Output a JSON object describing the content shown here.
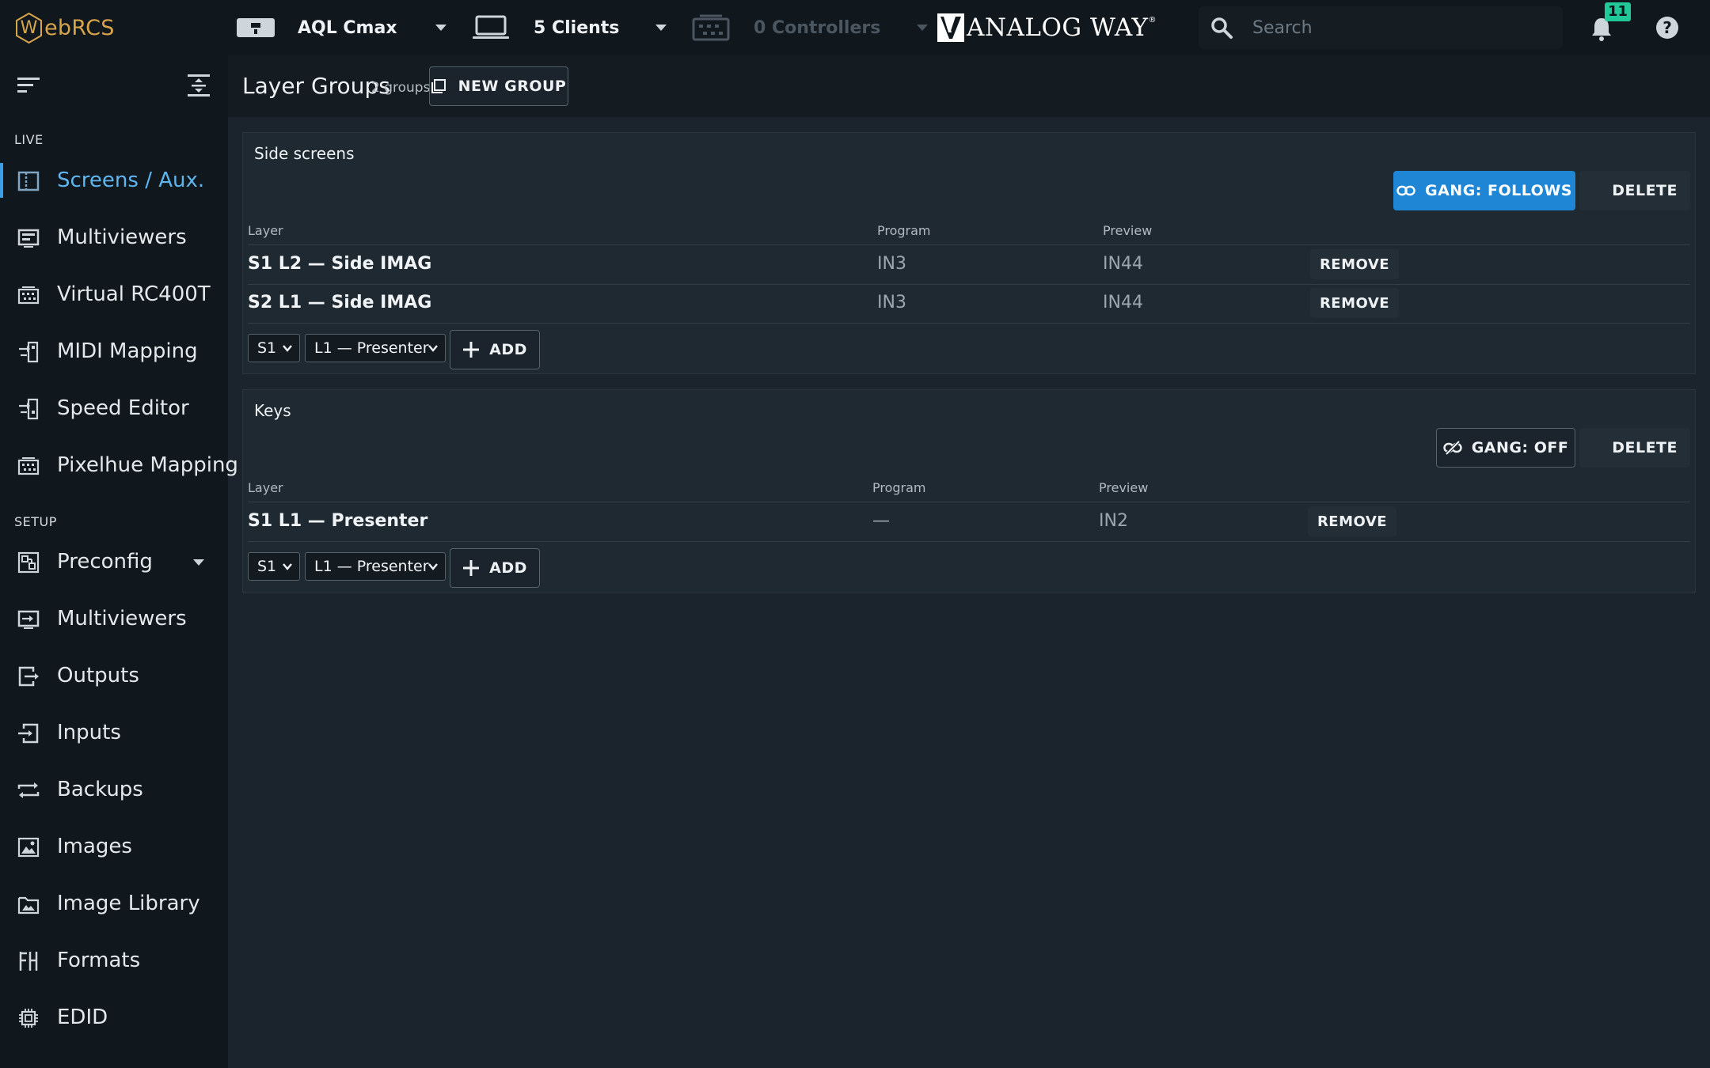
{
  "app": {
    "logo_letter": "W",
    "logo_rest": "ebRCS"
  },
  "topbar": {
    "device": "AQL Cmax",
    "clients": "5 Clients",
    "controllers": "0 Controllers",
    "brand": "ANALOG WAY",
    "brand_reg": "®",
    "search_placeholder": "Search",
    "notifications_count": "11"
  },
  "sidebar": {
    "live_label": "LIVE",
    "setup_label": "SETUP",
    "live_items": [
      {
        "label": "Screens / Aux.",
        "icon": "screens-icon",
        "active": true
      },
      {
        "label": "Multiviewers",
        "icon": "multiviewer-icon"
      },
      {
        "label": "Virtual RC400T",
        "icon": "keyboard-icon"
      },
      {
        "label": "MIDI Mapping",
        "icon": "midi-icon"
      },
      {
        "label": "Speed Editor",
        "icon": "speed-editor-icon"
      },
      {
        "label": "Pixelhue Mapping",
        "icon": "keyboard-icon"
      }
    ],
    "setup_items": [
      {
        "label": "Preconfig",
        "icon": "preconfig-icon"
      },
      {
        "label": "Multiviewers",
        "icon": "multiviewer-setup-icon"
      },
      {
        "label": "Outputs",
        "icon": "outputs-icon"
      },
      {
        "label": "Inputs",
        "icon": "inputs-icon"
      },
      {
        "label": "Backups",
        "icon": "backups-icon"
      },
      {
        "label": "Images",
        "icon": "images-icon"
      },
      {
        "label": "Image Library",
        "icon": "image-library-icon"
      },
      {
        "label": "Formats",
        "icon": "formats-icon"
      },
      {
        "label": "EDID",
        "icon": "chip-icon"
      }
    ]
  },
  "header": {
    "title": "Layer Groups",
    "subtitle": "2 groups",
    "new_group_label": "NEW GROUP"
  },
  "columns": {
    "layer": "Layer",
    "program": "Program",
    "preview": "Preview"
  },
  "groups": [
    {
      "name": "Side screens",
      "gang_label": "GANG: FOLLOWS",
      "delete_label": "DELETE",
      "rows": [
        {
          "layer": "S1 L2 — Side IMAG",
          "program": "IN3",
          "preview": "IN44",
          "remove": "REMOVE"
        },
        {
          "layer": "S2 L1 — Side IMAG",
          "program": "IN3",
          "preview": "IN44",
          "remove": "REMOVE"
        }
      ],
      "screen_select": "S1",
      "layer_select": "L1 — Presenter",
      "add_label": "ADD"
    },
    {
      "name": "Keys",
      "gang_label": "GANG: OFF",
      "delete_label": "DELETE",
      "rows": [
        {
          "layer": "S1 L1 — Presenter",
          "program": "—",
          "preview": "IN2",
          "remove": "REMOVE"
        }
      ],
      "screen_select": "S1",
      "layer_select": "L1 — Presenter",
      "add_label": "ADD"
    }
  ],
  "colors": {
    "accent": "#1f86d6",
    "active_nav": "#5eb6f0",
    "logo": "#d9a54a",
    "badge": "#21c89a"
  }
}
